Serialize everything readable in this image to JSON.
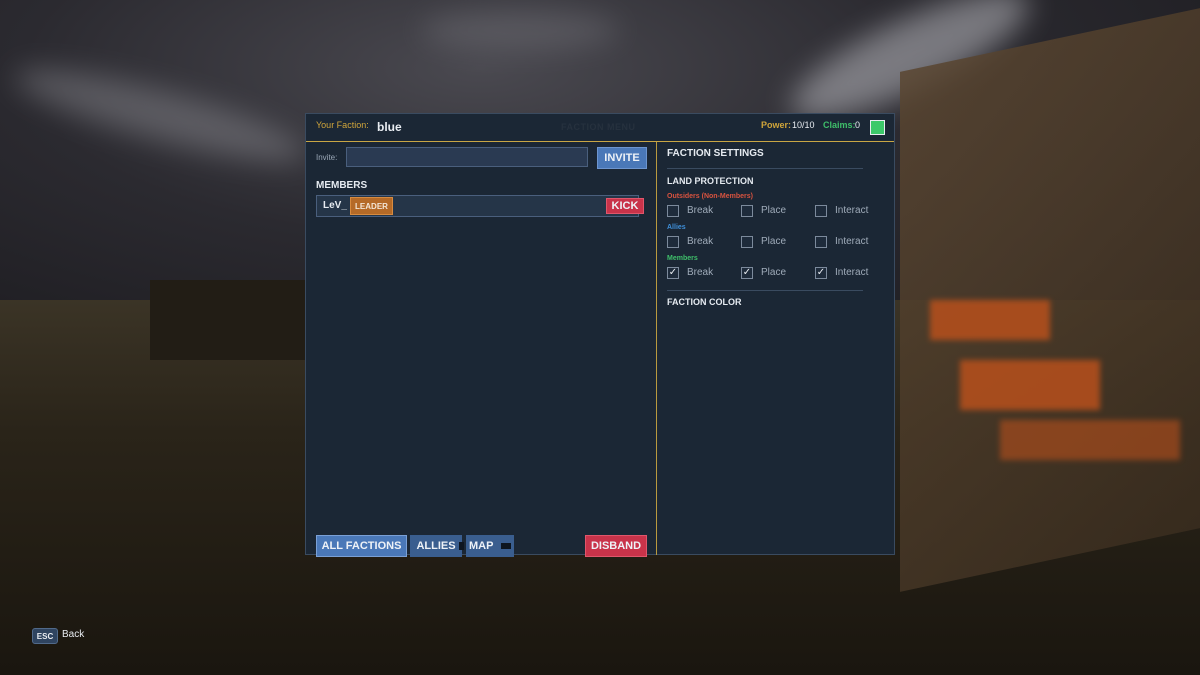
{
  "header": {
    "faction_label": "Your Faction:",
    "faction_name": "blue",
    "menu_title": "FACTION MENU",
    "power_label": "Power:",
    "power_value": "10/10",
    "claims_label": "Claims:",
    "claims_value": "0",
    "faction_color": "#3cc96a"
  },
  "left": {
    "invite_label": "Invite:",
    "invite_value": "",
    "invite_button": "INVITE",
    "members_heading": "MEMBERS",
    "members": [
      {
        "name": "LeV_",
        "role": "LEADER",
        "kick_label": "KICK"
      }
    ],
    "footer": {
      "all_factions": "ALL FACTIONS",
      "allies": "ALLIES",
      "map": "MAP",
      "disband": "DISBAND"
    }
  },
  "right": {
    "settings_title": "FACTION SETTINGS",
    "land_protection_title": "LAND PROTECTION",
    "groups": [
      {
        "label": "Outsiders (Non-Members)",
        "color": "#d9533f",
        "options": [
          {
            "label": "Break",
            "checked": false
          },
          {
            "label": "Place",
            "checked": false
          },
          {
            "label": "Interact",
            "checked": false
          }
        ]
      },
      {
        "label": "Allies",
        "color": "#3f8fd9",
        "options": [
          {
            "label": "Break",
            "checked": false
          },
          {
            "label": "Place",
            "checked": false
          },
          {
            "label": "Interact",
            "checked": false
          }
        ]
      },
      {
        "label": "Members",
        "color": "#3fbf6a",
        "options": [
          {
            "label": "Break",
            "checked": true
          },
          {
            "label": "Place",
            "checked": true
          },
          {
            "label": "Interact",
            "checked": true
          }
        ]
      }
    ],
    "faction_color_title": "FACTION COLOR"
  },
  "hint": {
    "key": "ESC",
    "label": "Back"
  },
  "colors": {
    "accent_gold": "#c9a644",
    "button_blue": "#4a78b8",
    "button_red": "#c9334a",
    "leader_orange": "#b56a27",
    "panel_bg": "#1b2735"
  }
}
